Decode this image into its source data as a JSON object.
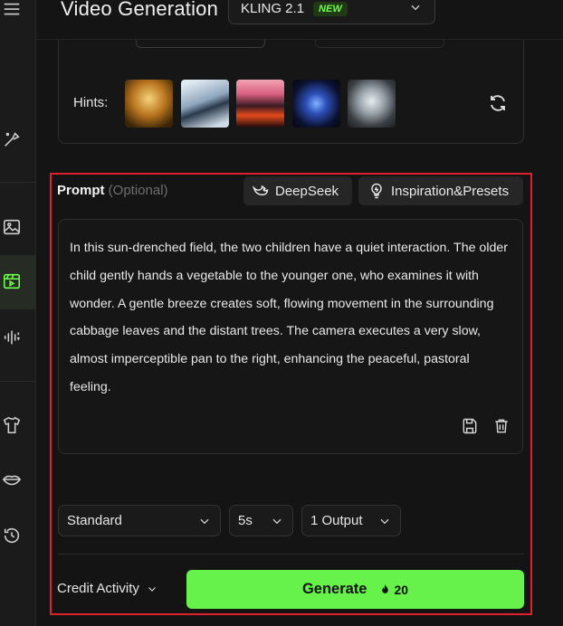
{
  "header": {
    "title": "Video Generation",
    "model": {
      "name": "KLING 2.1",
      "badge": "NEW"
    }
  },
  "hints": {
    "label": "Hints:",
    "thumbnails": [
      "hint-image-1",
      "hint-image-2",
      "hint-image-3",
      "hint-image-4",
      "hint-image-5"
    ]
  },
  "prompt": {
    "label": "Prompt",
    "optional": "(Optional)",
    "deepseek_label": "DeepSeek",
    "inspiration_label": "Inspiration&Presets",
    "text": "In this sun-drenched field, the two children have a quiet interaction. The older child gently hands a vegetable to the younger one, who examines it with wonder. A gentle breeze creates soft, flowing movement in the surrounding cabbage leaves and the distant trees. The camera executes a very slow, almost imperceptible pan to the right, enhancing the peaceful, pastoral feeling."
  },
  "settings": {
    "mode": "Standard",
    "duration": "5s",
    "outputs": "1 Output"
  },
  "footer": {
    "credit_label": "Credit Activity",
    "generate_label": "Generate",
    "generate_cost": "20"
  },
  "colors": {
    "accent": "#66f24a",
    "highlight": "#e0202a",
    "badge_text": "#6dff4b"
  }
}
